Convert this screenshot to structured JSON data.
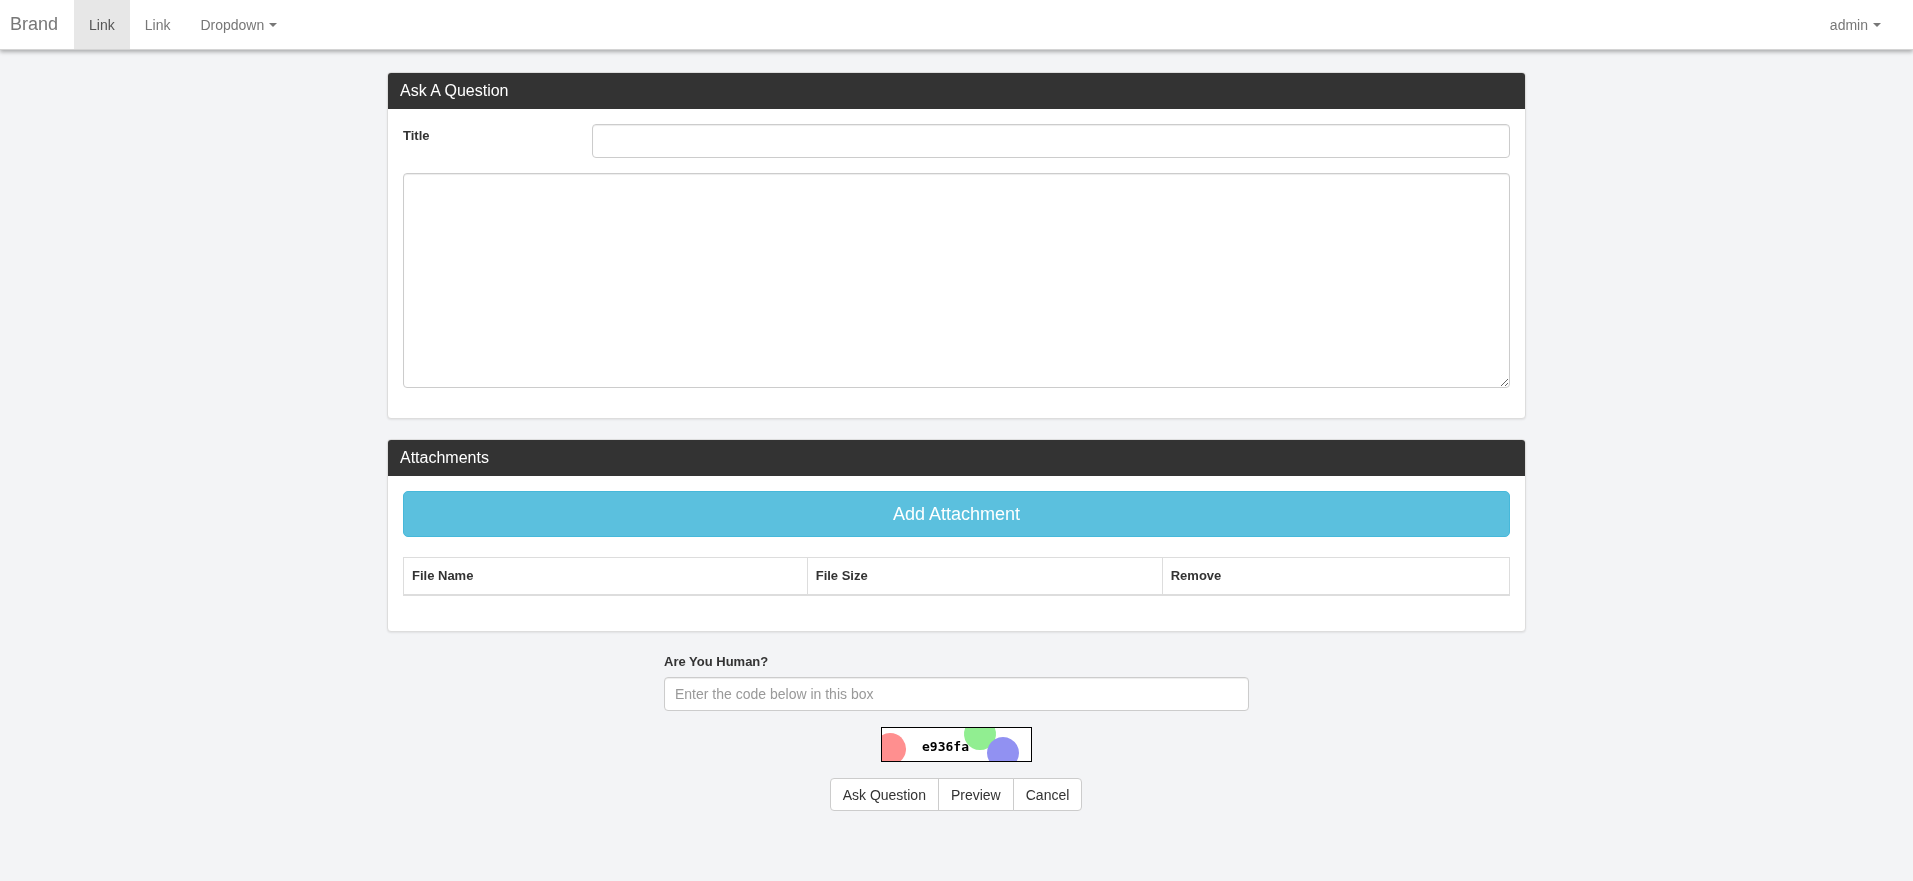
{
  "navbar": {
    "brand": "Brand",
    "links": [
      {
        "label": "Link",
        "kind": "link",
        "selected": true
      },
      {
        "label": "Link",
        "kind": "link",
        "selected": false
      },
      {
        "label": "Dropdown",
        "kind": "dropdown",
        "selected": false
      }
    ],
    "user_menu": {
      "label": "admin"
    }
  },
  "question_panel": {
    "heading": "Ask A Question",
    "title_label": "Title"
  },
  "attachments_panel": {
    "heading": "Attachments",
    "add_button": "Add Attachment",
    "table": {
      "columns": [
        "File Name",
        "File Size",
        "Remove"
      ]
    }
  },
  "captcha": {
    "label": "Are You Human?",
    "placeholder": "Enter the code below in this box",
    "code": "e936fa"
  },
  "buttons": [
    "Ask Question",
    "Preview",
    "Cancel"
  ]
}
